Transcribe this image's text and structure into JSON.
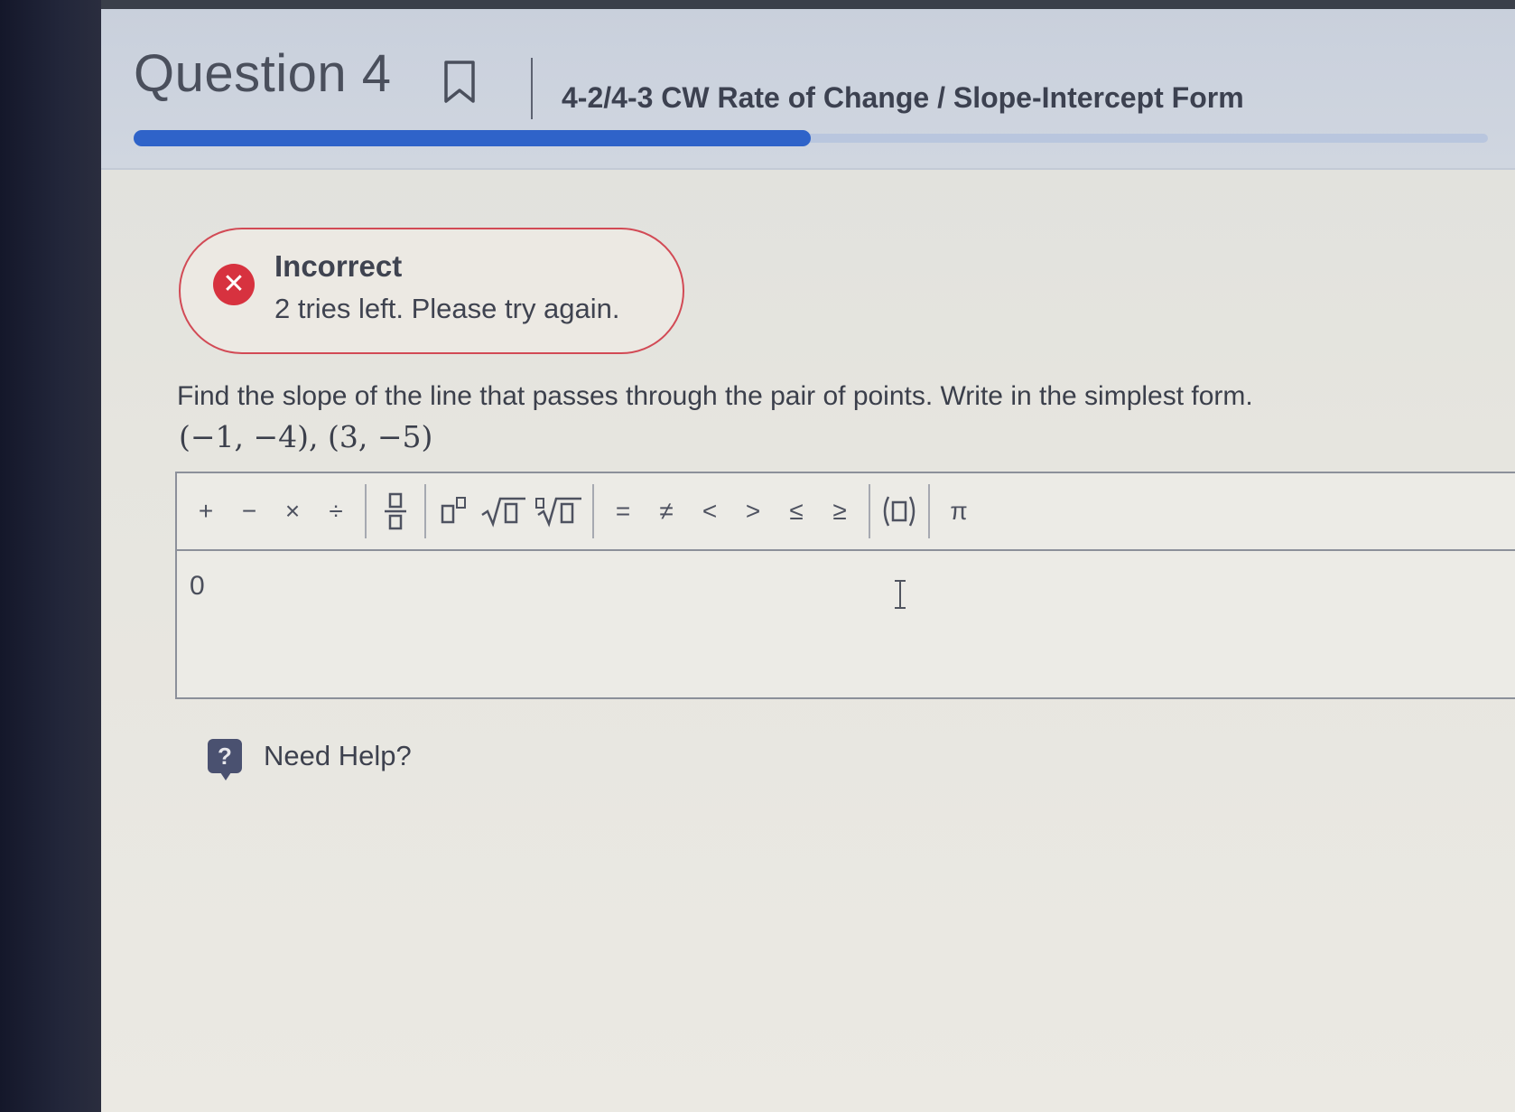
{
  "header": {
    "question_title": "Question 4",
    "assignment_title": "4-2/4-3 CW Rate of Change / Slope-Intercept Form",
    "progress_fraction": 0.5
  },
  "feedback": {
    "status": "Incorrect",
    "message": "2 tries left. Please try again.",
    "status_color": "#d7323f"
  },
  "question": {
    "prompt": "Find the slope of the line that passes through the pair of points. Write in the simplest form.",
    "points": "(−1, −4), (3, −5)"
  },
  "toolbar": {
    "group_arithmetic": [
      "+",
      "−",
      "×",
      "÷"
    ],
    "group_fraction": [
      "fraction-icon"
    ],
    "group_exponent": [
      "exponent-icon",
      "sqrt-icon",
      "nth-root-icon"
    ],
    "group_relations": [
      "=",
      "≠",
      "<",
      ">",
      "≤",
      "≥"
    ],
    "group_paren": [
      "parentheses-icon"
    ],
    "group_constants": [
      "π"
    ]
  },
  "answer": {
    "value": "0"
  },
  "help": {
    "label": "Need Help?",
    "icon_glyph": "?"
  },
  "colors": {
    "accent": "#2f63c9",
    "error": "#d24a55"
  }
}
